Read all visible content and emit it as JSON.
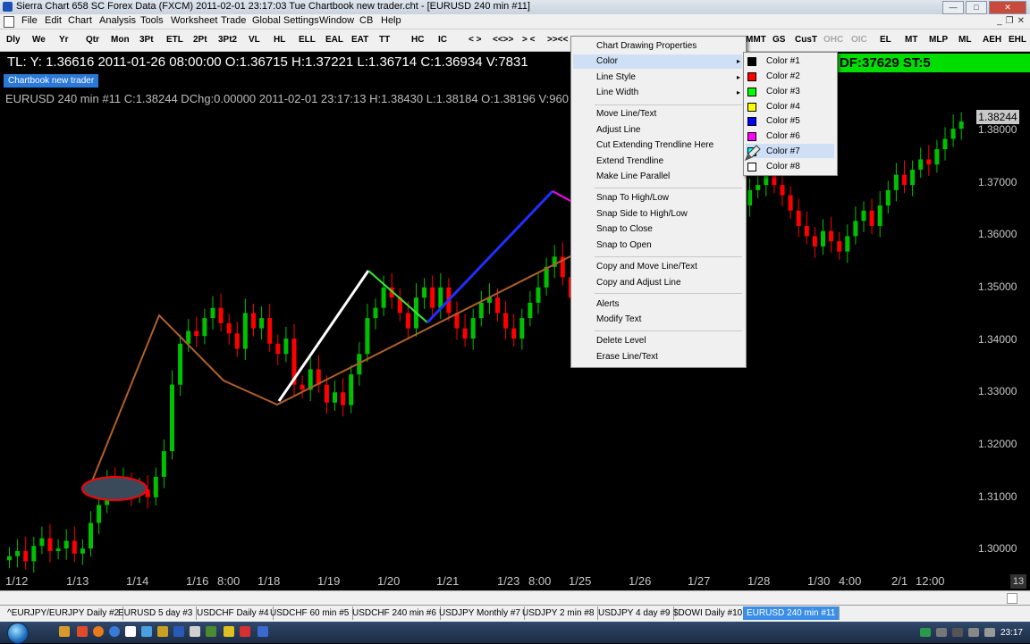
{
  "window": {
    "title": "Sierra Chart 658 SC Forex Data (FXCM) 2011-02-01  23:17:03  Tue    Chartbook new trader.cht - [EURUSD  240 min   #11]"
  },
  "menu": [
    "File",
    "Edit",
    "Chart",
    "Analysis",
    "Tools",
    "Worksheet",
    "Trade",
    "Global Settings",
    "Window",
    "CB",
    "Help"
  ],
  "toolbar": {
    "left": [
      "Dly",
      "We",
      "Yr",
      "Qtr",
      "Mon",
      "3Pt",
      "ETL",
      "2Pt",
      "3Pt2",
      "VL",
      "HL",
      "ELL",
      "EAL",
      "EAT",
      "TT",
      "HC",
      "IC",
      "< >",
      "<<>>",
      "> <",
      ">><<"
    ],
    "right": [
      "MMT",
      "GS",
      "CusT",
      "OHC",
      "OIC",
      "EL",
      "MT",
      "MLP",
      "ML",
      "AEH",
      "EHL"
    ],
    "right_disabled": [
      "OHC",
      "OIC"
    ]
  },
  "cursor_info": {
    "text": "TL: Y: 1.36616  2011-01-26  08:00:00  O:1.36715  H:1.37221  L:1.36714  C:1.36934  V:7831",
    "right_box": "DF:37629  ST:5"
  },
  "chart": {
    "name_tag": "Chartbook new trader",
    "header": "EURUSD  240 min   #11 C:1.38244 DChg:0.00000 2011-02-01 23:17:13 H:1.38430 L:1.38184 O:1.38196 V:960",
    "last_price": "1.38244",
    "bars_label": "13",
    "price_labels": [
      "1.38000",
      "1.37000",
      "1.36000",
      "1.35000",
      "1.34000",
      "1.33000",
      "1.32000",
      "1.31000",
      "1.30000"
    ],
    "date_labels": [
      "1/12",
      "1/13",
      "1/14",
      "1/16",
      "8:00",
      "1/18",
      "1/19",
      "1/20",
      "1/21",
      "1/23",
      "8:00",
      "1/25",
      "1/26",
      "1/27",
      "1/28",
      "1/30",
      "4:00",
      "2/1",
      "12:00"
    ]
  },
  "chart_data": {
    "type": "candlestick",
    "symbol": "EURUSD",
    "timeframe": "240 min",
    "ylim": [
      1.295,
      1.392
    ],
    "up_color": "#00c000",
    "down_color": "#ff0000",
    "closes": [
      1.2975,
      1.2985,
      1.2965,
      1.2995,
      1.301,
      1.2985,
      1.299,
      1.3005,
      1.298,
      1.299,
      1.304,
      1.3075,
      1.3125,
      1.311,
      1.312,
      1.3095,
      1.3105,
      1.309,
      1.313,
      1.318,
      1.331,
      1.339,
      1.3415,
      1.3405,
      1.344,
      1.346,
      1.343,
      1.341,
      1.338,
      1.345,
      1.342,
      1.344,
      1.339,
      1.337,
      1.34,
      1.331,
      1.33,
      1.334,
      1.331,
      1.3275,
      1.3295,
      1.327,
      1.333,
      1.337,
      1.344,
      1.346,
      1.35,
      1.348,
      1.345,
      1.342,
      1.348,
      1.35,
      1.346,
      1.35,
      1.345,
      1.342,
      1.34,
      1.344,
      1.347,
      1.348,
      1.345,
      1.342,
      1.34,
      1.344,
      1.347,
      1.35,
      1.354,
      1.356,
      1.352,
      1.348,
      1.347,
      1.351,
      1.355,
      1.358,
      1.361,
      1.36,
      1.359,
      1.363,
      1.361,
      1.364,
      1.357,
      1.36,
      1.358,
      1.354,
      1.352,
      1.358,
      1.362,
      1.366,
      1.368,
      1.367,
      1.366,
      1.369,
      1.37,
      1.372,
      1.37,
      1.368,
      1.365,
      1.362,
      1.36,
      1.358,
      1.361,
      1.359,
      1.357,
      1.36,
      1.363,
      1.365,
      1.362,
      1.366,
      1.369,
      1.372,
      1.37,
      1.373,
      1.375,
      1.374,
      1.377,
      1.379,
      1.381,
      1.3824
    ]
  },
  "context_menu": {
    "items": [
      "Chart Drawing Properties",
      "Color",
      "Line Style",
      "Line Width",
      "Move Line/Text",
      "Adjust Line",
      "Cut Extending Trendline Here",
      "Extend Trendline",
      "Make Line Parallel",
      "Snap To High/Low",
      "Snap Side to High/Low",
      "Snap to Close",
      "Snap to Open",
      "Copy and Move Line/Text",
      "Copy and Adjust Line",
      "Alerts",
      "Modify Text",
      "Delete Level",
      "Erase Line/Text"
    ],
    "highlighted": "Color",
    "submenu_arrow": "▸"
  },
  "color_submenu": {
    "items": [
      {
        "label": "Color #1",
        "color": "#000000"
      },
      {
        "label": "Color #2",
        "color": "#ff0000"
      },
      {
        "label": "Color #3",
        "color": "#00ff00"
      },
      {
        "label": "Color #4",
        "color": "#ffff00"
      },
      {
        "label": "Color #5",
        "color": "#0000ff"
      },
      {
        "label": "Color #6",
        "color": "#ff00ff"
      },
      {
        "label": "Color #7",
        "color": "#00ffff"
      },
      {
        "label": "Color #8",
        "color": "#ffffff"
      }
    ],
    "highlighted": "Color #7"
  },
  "chartbook_tabs": [
    {
      "label": "^EURJPY/EURJPY  Daily  #2",
      "active": false
    },
    {
      "label": "EURUSD  5 day  #3",
      "active": false
    },
    {
      "label": "USDCHF  Daily  #4",
      "active": false
    },
    {
      "label": "USDCHF  60 min  #5",
      "active": false
    },
    {
      "label": "USDCHF  240 min  #6",
      "active": false
    },
    {
      "label": "USDJPY  Monthly  #7",
      "active": false
    },
    {
      "label": "USDJPY  2 min  #8",
      "active": false
    },
    {
      "label": "USDJPY  4 day  #9",
      "active": false
    },
    {
      "label": "$DOWI  Daily  #10",
      "active": false
    },
    {
      "label": "EURUSD  240 min  #11",
      "active": true
    }
  ],
  "taskbar": {
    "clock": "23:17"
  }
}
